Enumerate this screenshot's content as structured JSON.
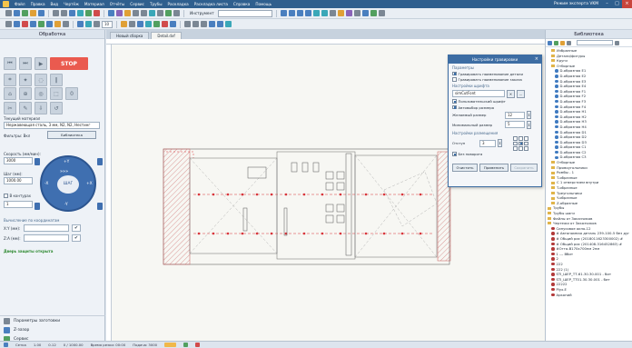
{
  "menu": {
    "items": [
      "Файл",
      "Правка",
      "Вид",
      "Чертёж",
      "Материал",
      "Отчёты",
      "Сервис",
      "Трубы",
      "Раскладка",
      "Раскладка листа",
      "Справка",
      "Помощь"
    ],
    "mode": "Режим эксперта VKM"
  },
  "toolbar": {
    "tool_label": "Инструмент",
    "zoom_value": "10"
  },
  "left_panel": {
    "title": "Обработка",
    "stop_label": "STOP",
    "material_label": "Текущий материал",
    "material_value": "Нержавеющая сталь, 3 мм, N2, N2, Нестинг",
    "filters_label": "Фильтры: Вкл",
    "library_button": "Библиотека",
    "speed_label": "Скорость (мм/мин):",
    "speed_value": "3000",
    "step_label": "Шаг (мм):",
    "step_value": "1000.00",
    "in_contour_label": "В контурах",
    "in_contour_value": "1",
    "jog": {
      "up": "+Y",
      "down": "-Y",
      "left": "-X",
      "right": "+X",
      "center": "ШАГ",
      "fast": "»»»"
    },
    "coords_title": "Вычисление по координатам",
    "coord_x_label": "X:Y (мм):",
    "coord_z_label": "Z:A (мм):",
    "protection": "Дверь защиты открыта",
    "bottom_items": [
      "Параметры заготовки",
      "Z-зазор",
      "Сервис"
    ]
  },
  "tabs": [
    "Новый сборка",
    "Detail.dxf"
  ],
  "dialog": {
    "title": "Настройки гравировки",
    "section1": "Параметры",
    "check1": "Гравировать наименование детали",
    "check2": "Гравировать наименование заказа",
    "section2": "Настройки шрифта",
    "font_value": "simCutFont",
    "check3": "Пользовательский шрифт",
    "check4": "Автовыбор размера",
    "max_size_label": "Желаемый размер",
    "max_size_value": "12",
    "min_size_label": "Минимальный размер",
    "min_size_value": "5",
    "section3": "Настройки размещения",
    "offset_label": "Отступ",
    "offset_value": "3",
    "rotate_label": "Без поворота",
    "btn_clear": "Очистить",
    "btn_apply": "Применить",
    "btn_save": "Сохранить"
  },
  "right_panel": {
    "title": "Библиотека",
    "tree": [
      {
        "t": "Избранные",
        "k": "folder",
        "d": 1
      },
      {
        "t": "Детали/фигуры",
        "k": "folder",
        "d": 1
      },
      {
        "t": "Круги",
        "k": "folder",
        "d": 1
      },
      {
        "t": "Отборные",
        "k": "folder",
        "d": 1
      },
      {
        "t": "D-образная E1",
        "k": "item",
        "d": 2
      },
      {
        "t": "D-образная E2",
        "k": "item",
        "d": 2
      },
      {
        "t": "D-образная E3",
        "k": "item",
        "d": 2
      },
      {
        "t": "D-образная E4",
        "k": "item",
        "d": 2
      },
      {
        "t": "D-образная F1",
        "k": "item",
        "d": 2
      },
      {
        "t": "D-образная F2",
        "k": "item",
        "d": 2
      },
      {
        "t": "D-образная F3",
        "k": "item",
        "d": 2
      },
      {
        "t": "D-образная F4",
        "k": "item",
        "d": 2
      },
      {
        "t": "D-образная H1",
        "k": "item",
        "d": 2
      },
      {
        "t": "D-образная H2",
        "k": "item",
        "d": 2
      },
      {
        "t": "D-образная H3",
        "k": "item",
        "d": 2
      },
      {
        "t": "D-образная H4",
        "k": "item",
        "d": 2
      },
      {
        "t": "D-образная D1",
        "k": "item",
        "d": 2
      },
      {
        "t": "D-образная D2",
        "k": "item",
        "d": 2
      },
      {
        "t": "D-образная D3",
        "k": "item",
        "d": 2
      },
      {
        "t": "D-образная C1",
        "k": "item",
        "d": 2
      },
      {
        "t": "D-образная C2",
        "k": "item",
        "d": 2
      },
      {
        "t": "D-образная C3",
        "k": "item",
        "d": 2
      },
      {
        "t": "Отборные",
        "k": "folder",
        "d": 1
      },
      {
        "t": "Прямоугольники",
        "k": "folder",
        "d": 1
      },
      {
        "t": "Ромбы - 1",
        "k": "folder",
        "d": 1
      },
      {
        "t": "T-образные",
        "k": "folder",
        "d": 1
      },
      {
        "t": "С 1 отверстием внутри",
        "k": "folder",
        "d": 1
      },
      {
        "t": "T-образные",
        "k": "folder",
        "d": 1
      },
      {
        "t": "Треугольники",
        "k": "folder",
        "d": 1
      },
      {
        "t": "Y-образные",
        "k": "folder",
        "d": 1
      },
      {
        "t": "Z-образные",
        "k": "folder",
        "d": 1
      },
      {
        "t": "Трубы",
        "k": "folder",
        "d": 0
      },
      {
        "t": "Трубы шаги",
        "k": "folder",
        "d": 0
      },
      {
        "t": "Файлы от Заказчиков",
        "k": "folder",
        "d": 0
      },
      {
        "t": "Чертежи от Заказчиков",
        "k": "folder",
        "d": 0
      },
      {
        "t": "Синусовое окно-12",
        "k": "item2",
        "d": 1
      },
      {
        "t": "# Автономная деталь 239-100-5 без дуг",
        "k": "item2",
        "d": 1
      },
      {
        "t": "# Общий рис (2018011623300002) #",
        "k": "item2",
        "d": 1
      },
      {
        "t": "# Общий рис (201408-316452863) #",
        "k": "item2",
        "d": 1
      },
      {
        "t": "#Огта-В170х700нм  2нм",
        "k": "item2",
        "d": 1
      },
      {
        "t": "1 --- Вбит",
        "k": "item2",
        "d": 1
      },
      {
        "t": "2",
        "k": "item2",
        "d": 1
      },
      {
        "t": "222",
        "k": "item2",
        "d": 1
      },
      {
        "t": "222 (1)",
        "k": "item2",
        "d": 1
      },
      {
        "t": "STI_ШЕР_ТТ-61.30.30.001 - бит",
        "k": "item2",
        "d": 1
      },
      {
        "t": "STI_ШЕР_ТТ01.30.30.001 - бит",
        "k": "item2",
        "d": 1
      },
      {
        "t": "22222",
        "k": "item2",
        "d": 1
      },
      {
        "t": "Plyx.E",
        "k": "item2",
        "d": 1
      },
      {
        "t": "Арконий",
        "k": "item2",
        "d": 1
      }
    ]
  },
  "status": {
    "items": [
      "Сетка",
      "1.00",
      "0.12",
      "0 / 1000.00",
      "Время резки: 00:00",
      "Подача: 3000"
    ]
  },
  "colors": {
    "accent": "#3d6da3",
    "stop": "#ea5a4f",
    "jog": "#3f6fb0",
    "cut_red": "#d8343a"
  }
}
